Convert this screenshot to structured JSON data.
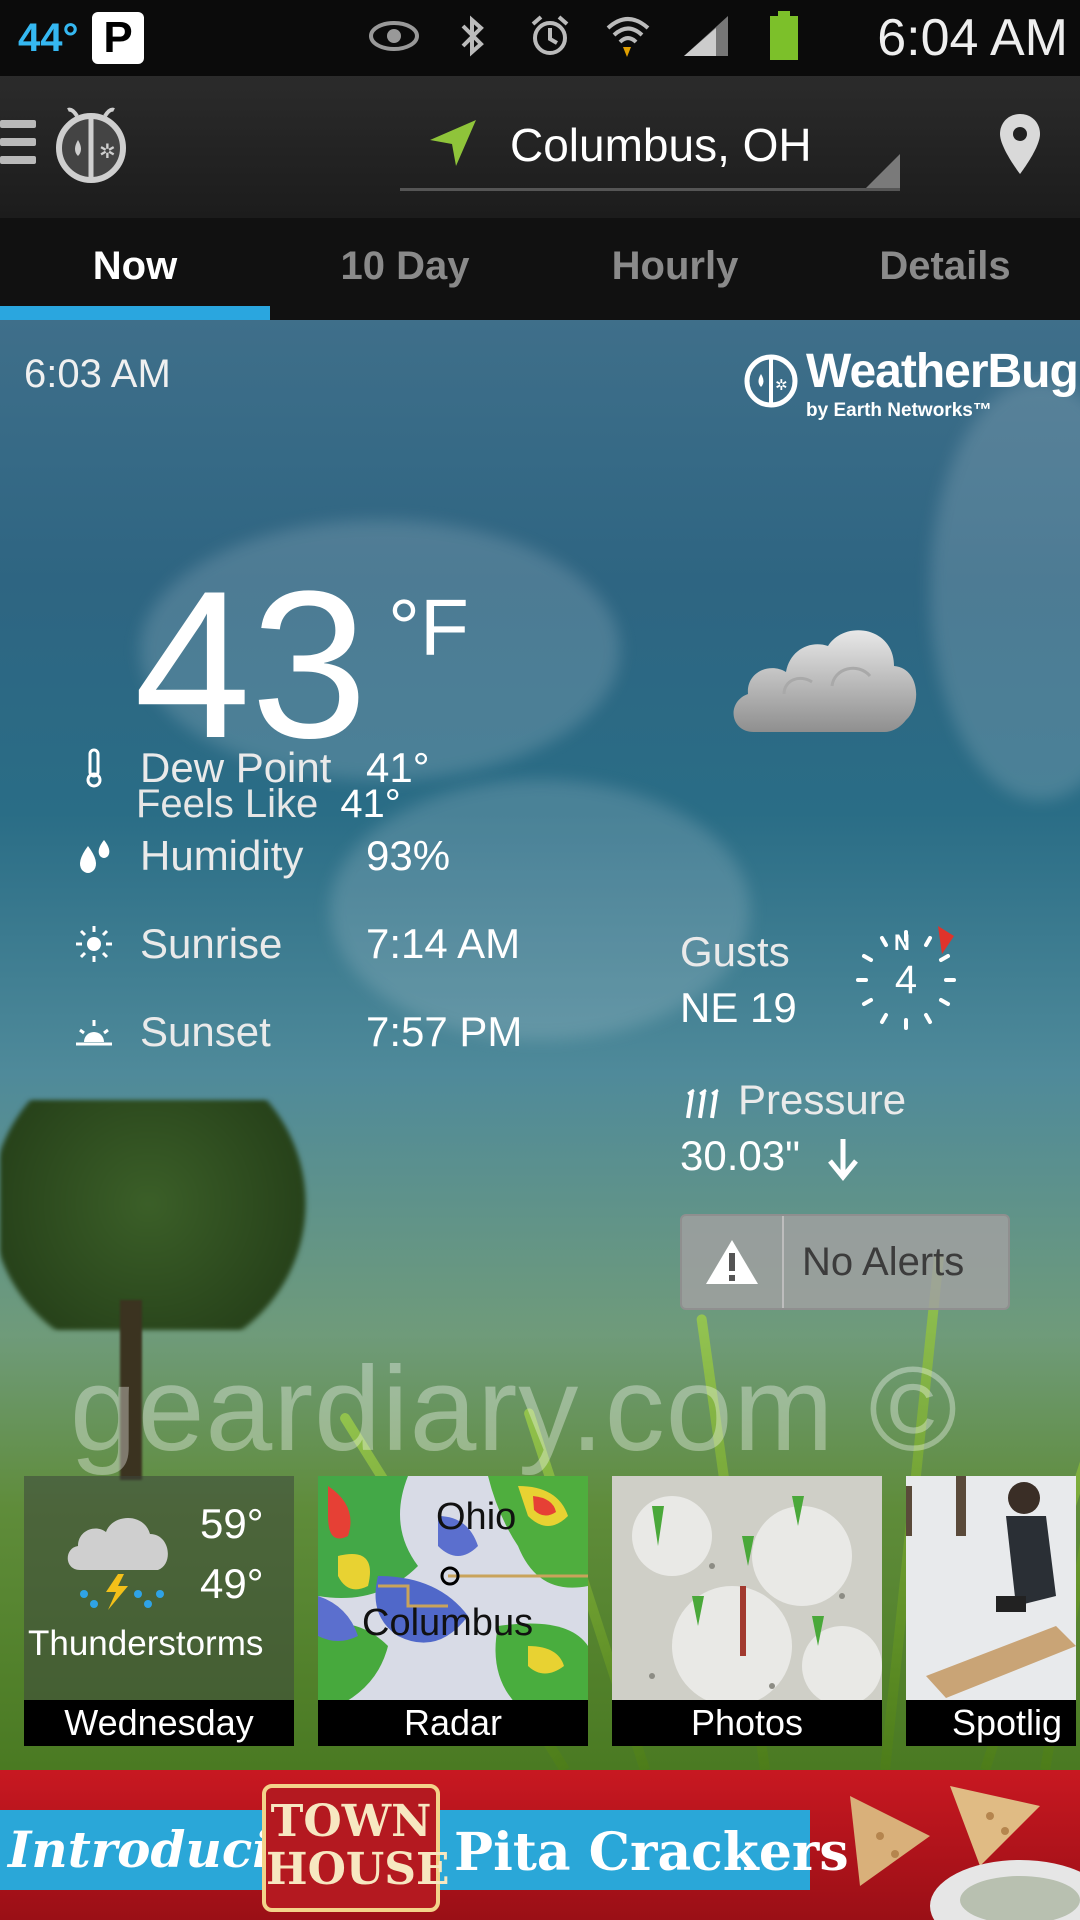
{
  "status_bar": {
    "temperature": "44°",
    "parking_badge": "P",
    "time": "6:04 AM",
    "icons": [
      "eye-icon",
      "bluetooth-icon",
      "alarm-icon",
      "wifi-icon",
      "signal-icon",
      "battery-icon"
    ]
  },
  "app_bar": {
    "location": "Columbus, OH"
  },
  "tabs": [
    {
      "label": "Now",
      "active": true
    },
    {
      "label": "10 Day",
      "active": false
    },
    {
      "label": "Hourly",
      "active": false
    },
    {
      "label": "Details",
      "active": false
    }
  ],
  "current": {
    "observation_time": "6:03 AM",
    "temperature": "43",
    "unit": "°F",
    "feels_like_label": "Feels Like",
    "feels_like_value": "41°",
    "condition_icon": "cloudy-icon"
  },
  "brand": {
    "name": "WeatherBug",
    "byline": "by Earth Networks™"
  },
  "details": [
    {
      "label": "Dew Point",
      "value": "41°",
      "icon": "thermometer-icon"
    },
    {
      "label": "Humidity",
      "value": "93%",
      "icon": "humidity-icon"
    },
    {
      "label": "Sunrise",
      "value": "7:14 AM",
      "icon": "sunrise-icon"
    },
    {
      "label": "Sunset",
      "value": "7:57 PM",
      "icon": "sunset-icon"
    }
  ],
  "wind": {
    "label": "Gusts",
    "value": "NE 19",
    "speed": "4",
    "compass_n": "N",
    "direction": "NE"
  },
  "pressure": {
    "label": "Pressure",
    "value": "30.03\"",
    "trend": "falling"
  },
  "alerts": {
    "label": "No Alerts"
  },
  "watermark": "geardiary.com ©",
  "tiles": [
    {
      "caption": "Wednesday",
      "high": "59°",
      "low": "49°",
      "condition": "Thunderstorms",
      "icon": "thunderstorm-icon"
    },
    {
      "caption": "Radar",
      "map_labels": [
        "Ohio",
        "Columbus"
      ]
    },
    {
      "caption": "Photos"
    },
    {
      "caption": "Spotlig"
    }
  ],
  "ad": {
    "intro": "Introducing",
    "brand_line1": "TOWN",
    "brand_line2": "HOUSE",
    "product": "Pita Crackers"
  },
  "colors": {
    "accent": "#2aa6df",
    "status_temp": "#35b8f2",
    "ad_red": "#c81821",
    "ad_blue": "#2aa7d8"
  }
}
